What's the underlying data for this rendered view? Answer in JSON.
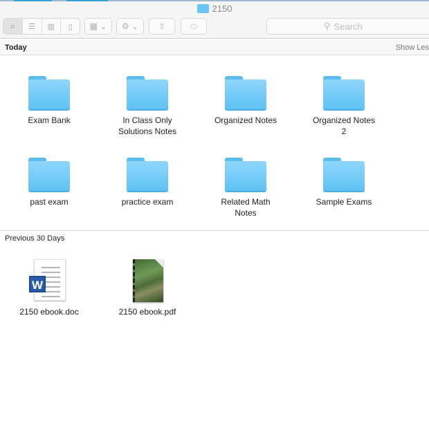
{
  "window": {
    "title": "2150"
  },
  "toolbar": {
    "view_modes": [
      {
        "name": "icon",
        "icon": "grid-icon",
        "active": true
      },
      {
        "name": "list",
        "icon": "list-icon"
      },
      {
        "name": "columns",
        "icon": "columns-icon"
      },
      {
        "name": "coverflow",
        "icon": "coverflow-icon"
      }
    ],
    "search_placeholder": "Search"
  },
  "sections": [
    {
      "title": "Today",
      "action": "Show Les",
      "items": [
        {
          "name": "Exam Bank"
        },
        {
          "name": "In Class Only Solutions Notes"
        },
        {
          "name": "Organized Notes"
        },
        {
          "name": "Organized Notes 2"
        },
        {
          "name": "past exam"
        },
        {
          "name": "practice exam"
        },
        {
          "name": "Related Math Notes"
        },
        {
          "name": "Sample Exams"
        }
      ]
    },
    {
      "title": "Previous 30 Days",
      "items": [
        {
          "name": "2150 ebook.doc",
          "type": "word-document"
        },
        {
          "name": "2150 ebook.pdf",
          "type": "pdf-document"
        }
      ]
    }
  ],
  "colors": {
    "folder": "#6cc6f4",
    "accent": "#2ea3dc"
  }
}
